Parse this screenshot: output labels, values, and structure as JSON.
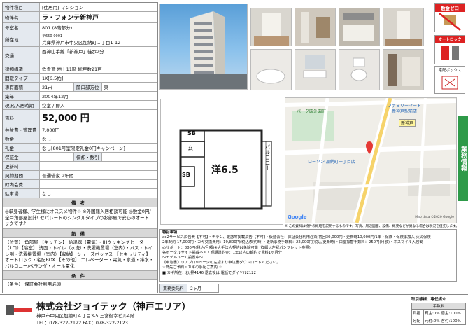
{
  "spec": {
    "category_label": "物件種目",
    "category_value": "[住居用] マンション",
    "name_label": "物件名",
    "name_value": "ラ・フォンテ新神戸",
    "room_label": "号室名",
    "room_value": "801 (8階部分)",
    "address_label": "所在地",
    "address_zip": "〒650-0001",
    "address_value": "兵庫県神戸市中央区加納町１丁目1-12",
    "traffic_label": "交通",
    "traffic_value": "西神山手線「新神戸」徒歩2分",
    "structure_label": "建物構造",
    "structure_value": "鉄骨造 地上11階 総戸数21戸",
    "layout_label": "間取タイプ",
    "layout_value": "1K[6.5帖]",
    "area_label": "専有面積",
    "area_value": "21㎡",
    "opening_label": "開口部方位",
    "opening_value": "東",
    "built_label": "築年",
    "built_value": "2004年12月",
    "status_label": "現況/入居時期",
    "status_value": "空室 / 即入",
    "rent_label": "賃料",
    "rent_value": "52,000 円",
    "common_label": "共益費・管理費",
    "common_value": "7,000円",
    "deposit_label": "敷金",
    "deposit_value": "なし",
    "key_label": "礼金",
    "key_value": "なし[801号室限定礼金0円キャンペーン]",
    "guarantee_label": "保証金",
    "guarantee_value": "",
    "refund_label": "償却・敷引",
    "refund_value": "",
    "renewal_label": "更新料",
    "renewal_value": "",
    "contract_label": "契約期間",
    "contract_value": "普通借家 2年間",
    "insurance_label": "町内会費",
    "insurance_value": "",
    "parking_label": "駐車場",
    "parking_value": "なし",
    "notes_header": "備考",
    "notes_text": "◎単身者様、学生様にオススメ物件☆ ※外国籍入居相談可能 ◎敷金0円/全戸角部屋設計! セパレートのシングルタイプのお部屋で安心のオートロックです♪",
    "equip_header": "設備",
    "equip_text": "【位置】 角部屋 【キッチン】 給湯器（電気）・IHクッキングヒーター（1口）【浴室】 洗面・トイレ（水洗）・洗濯機置場（室内）・バス・トイレ別・洗濯機置場（室内）【収納】 シューズボックス 【セキュリティ】 オートロック・宅配BOX 【その他】 エレベーター・電気・水道・排水・バルコニー/ベランダ・オール電化",
    "cond_header": "条件",
    "cond_label": "【条件】",
    "cond_value": "保証会社利用必須"
  },
  "floorplan": {
    "sb_top": "SB",
    "entry": "玄",
    "room": "洋6.5",
    "sb_bottom": "SB",
    "balcony": "バルコニー"
  },
  "map": {
    "park": "パーク園外園町",
    "family": "ファミリーマート",
    "family2": "新神戸駅前店",
    "lawson": "ローソン 加納町一丁目店",
    "station": "新神戸",
    "credit": "Map data ©2020 Google",
    "google": "Google"
  },
  "map_note": "※ この資料は物件の概略を説明するものです。写真、周辺図面、設備、概要などが異なる場合は現況を優先します。",
  "remarks": {
    "title": "特記事項",
    "line1": "ao2サービス広告費【不可】・チラシ、雑誌等掲載広告【不可】・仮延会社：保証会社利用必須 初回30,000円・更新時10,000円/1年・保険・保険事加入 火災保険",
    "line2": "2年契約 17,000円・カギ交換費用：19,800円(税込/契約時)・更新事務手数料：22,000円(税込/更新時)・口座振替手数料：250円(月額)・ホスマイル入居安",
    "line3": "心サポート：880円(税込/月額)※大手法人契約は免除可能 (詳細は左記パンフレット参照)",
    "line4": "各ポータルサイト掲載不可・短期違約金：1年以内の解約で賃料1ヶ月分",
    "line5": "～モデルルーム設置中～",
    "line6": "《申込書》リアプロ≒ページの左記より申込書ダウンロードください。",
    "line7": "☆弊先ご予約・カギの手配ご案内 ☆",
    "line8": "■ カギ所在：お/昇4146 退去後は 電話でダイヤル2122"
  },
  "duties": {
    "label": "業務委託料",
    "value": "2ヶ月"
  },
  "company": {
    "name": "株式会社ジョイテック（神戸エリア）",
    "address": "神戸市中央区加納町４丁目3-5 三宮御幸ビル4階",
    "tel": "TEL：078-322-2122  FAX：078-322-2123"
  },
  "trade": {
    "title": "取引態様：専任媒介",
    "fee_header": "手数料",
    "row1_label": "負担",
    "row1_value": "貸主:0% 借主:100%",
    "row2_label": "分配",
    "row2_value": "元付:0% 客付:100%"
  },
  "badges": {
    "deposit_zero": "敷金ゼロ",
    "autolock": "オートロック",
    "delivery": "宅配ボックス",
    "side_tag": "業務情報"
  }
}
